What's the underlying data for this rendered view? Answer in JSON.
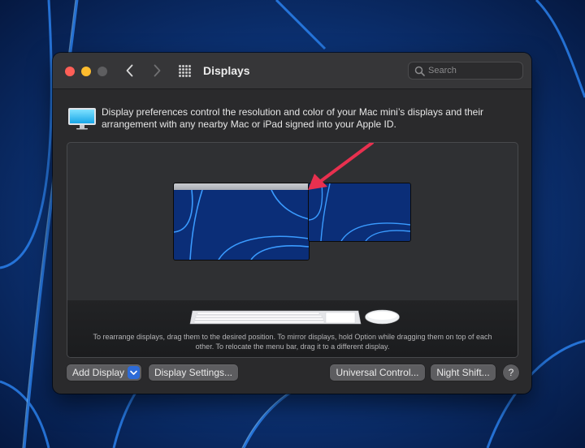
{
  "window": {
    "title": "Displays",
    "search_placeholder": "Search"
  },
  "info": {
    "text": "Display preferences control the resolution and color of your Mac mini’s displays and their arrangement with any nearby Mac or iPad signed into your Apple ID."
  },
  "arrangement": {
    "hint": "To rearrange displays, drag them to the desired position. To mirror displays, hold Option while dragging them on top of each other. To relocate the menu bar, drag it to a different display.",
    "displays": [
      "main-display",
      "secondary-display"
    ]
  },
  "buttons": {
    "add_display": "Add Display",
    "display_settings": "Display Settings...",
    "universal_control": "Universal Control...",
    "night_shift": "Night Shift...",
    "help": "?"
  },
  "icons": {
    "close": "close-traffic-light",
    "minimize": "minimize-traffic-light",
    "maximize": "maximize-traffic-light",
    "back": "chevron-left-icon",
    "forward": "chevron-right-icon",
    "show_all": "grid-icon",
    "search": "search-icon",
    "display": "display-icon",
    "keyboard": "keyboard-icon",
    "mouse": "mouse-icon",
    "dropdown": "chevron-down-icon"
  },
  "colors": {
    "wallpaper": "#0a2a66",
    "window_bg": "#2a2a2c",
    "accent": "#2d6bd8",
    "annotation_arrow": "#e8304f"
  }
}
